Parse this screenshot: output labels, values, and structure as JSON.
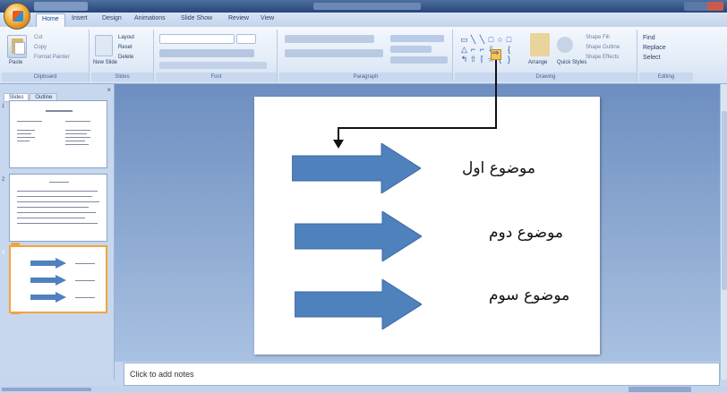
{
  "ribbon": {
    "tabs": [
      "Home",
      "Insert",
      "Design",
      "Animations",
      "Slide Show",
      "Review",
      "View"
    ],
    "active_tab": "Home",
    "groups": {
      "clipboard": {
        "paste": "Paste",
        "cut": "Cut",
        "copy": "Copy",
        "format_painter": "Format Painter",
        "label": "Clipboard"
      },
      "slides": {
        "new_slide": "New Slide",
        "layout": "Layout",
        "reset": "Reset",
        "delete": "Delete",
        "label": "Slides"
      },
      "font": {
        "label": "Font"
      },
      "paragraph": {
        "label": "Paragraph"
      },
      "drawing": {
        "arrange": "Arrange",
        "quick_styles": "Quick Styles",
        "shape_fill": "Shape Fill",
        "shape_outline": "Shape Outline",
        "shape_effects": "Shape Effects",
        "label": "Drawing"
      },
      "editing": {
        "find": "Find",
        "replace": "Replace",
        "select": "Select",
        "label": "Editing"
      }
    }
  },
  "left_pane": {
    "tabs": [
      "Slides",
      "Outline"
    ],
    "close": "×",
    "slide_numbers": [
      "1",
      "2",
      "3"
    ]
  },
  "slide": {
    "topics": [
      "موضوع اول",
      "موضوع دوم",
      "موضوع سوم"
    ]
  },
  "notes_placeholder": "Click to add notes",
  "colors": {
    "arrow_fill": "#4f81bd",
    "selected_thumbnail": "#f3a33b"
  }
}
